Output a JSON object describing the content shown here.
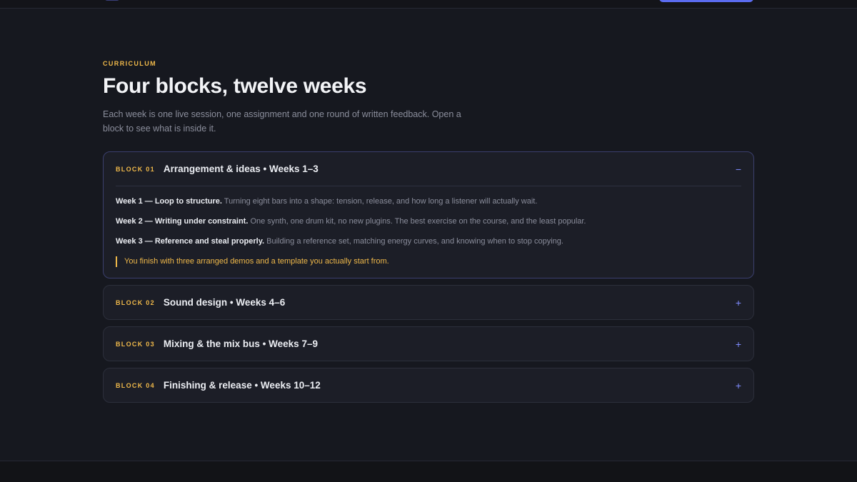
{
  "section": {
    "eyebrow": "CURRICULUM",
    "title": "Four blocks, twelve weeks",
    "subtitle": "Each week is one live session, one assignment and one round of written feedback. Open a block to see what is inside it."
  },
  "blocks": [
    {
      "code": "BLOCK 01",
      "title": "Arrangement & ideas • Weeks 1–3",
      "toggle": "−",
      "expanded": true,
      "weeks": [
        {
          "label": "Week 1 — Loop to structure.",
          "text": " Turning eight bars into a shape: tension, release, and how long a listener will actually wait."
        },
        {
          "label": "Week 2 — Writing under constraint.",
          "text": " One synth, one drum kit, no new plugins. The best exercise on the course, and the least popular."
        },
        {
          "label": "Week 3 — Reference and steal properly.",
          "text": " Building a reference set, matching energy curves, and knowing when to stop copying."
        }
      ],
      "outcome": "You finish with three arranged demos and a template you actually start from."
    },
    {
      "code": "BLOCK 02",
      "title": "Sound design • Weeks 4–6",
      "toggle": "+",
      "expanded": false
    },
    {
      "code": "BLOCK 03",
      "title": "Mixing & the mix bus • Weeks 7–9",
      "toggle": "+",
      "expanded": false
    },
    {
      "code": "BLOCK 04",
      "title": "Finishing & release • Weeks 10–12",
      "toggle": "+",
      "expanded": false
    }
  ],
  "colors": {
    "accent": "#f0b94a",
    "toggle": "#7f8cff",
    "background": "#16181f",
    "card": "#1c1e27"
  },
  "icons": {
    "collapse": "minus-icon",
    "expand": "plus-icon"
  }
}
